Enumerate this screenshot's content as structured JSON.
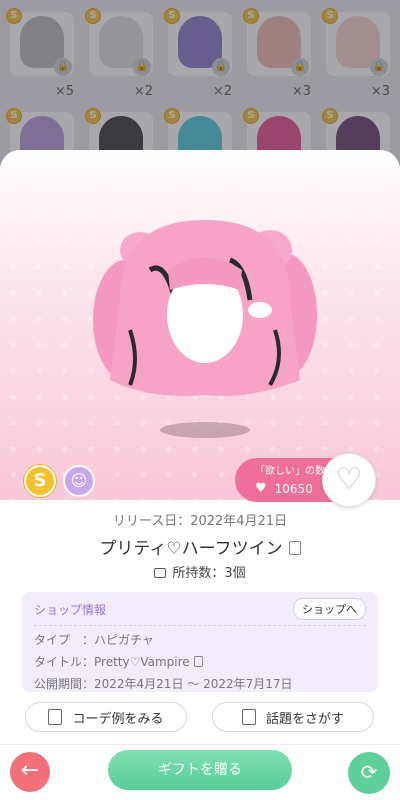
{
  "grid": {
    "row1": [
      {
        "count": "×5",
        "color": "#b9b9b9"
      },
      {
        "count": "×2",
        "color": "#2b2b2b"
      },
      {
        "count": "×2",
        "color": "#8c7bc9"
      },
      {
        "count": "×3",
        "color": "#f0b8b0"
      },
      {
        "count": "×3",
        "color": "#f6d2c9"
      }
    ],
    "row2": [
      {
        "color": "#b49ad8"
      },
      {
        "color": "#3a3a3a"
      },
      {
        "color": "#4fc8d8"
      },
      {
        "color": "#e64d8a"
      },
      {
        "color": "#6a3f6d"
      }
    ]
  },
  "item": {
    "currency_icon": "coin-icon",
    "avatar_icon": "avatar-icon",
    "want_label": "「欲しい」の数",
    "want_count": "10650",
    "release_label": "リリース日：2022年4月21日",
    "name": "プリティ♡ハーフツイン",
    "owned_label": "所持数：3個"
  },
  "shop": {
    "title": "ショップ情報",
    "link": "ショップへ",
    "type_line": "タイプ　：ハピガチャ",
    "title_line": "タイトル：Pretty♡Vampire",
    "period_line": "公開期間：2022年4月21日 ～ 2022年7月17日"
  },
  "actions": {
    "coord_label": "コーデ例をみる",
    "topic_label": "話題をさがす"
  },
  "bottom": {
    "back_symbol": "←",
    "gift_label": "ギフトを贈る",
    "swap_symbol": "⟳"
  },
  "colors": {
    "accent_pink": "#ee6f9c",
    "gift_green": "#58cc98",
    "back_red": "#f1707a"
  }
}
